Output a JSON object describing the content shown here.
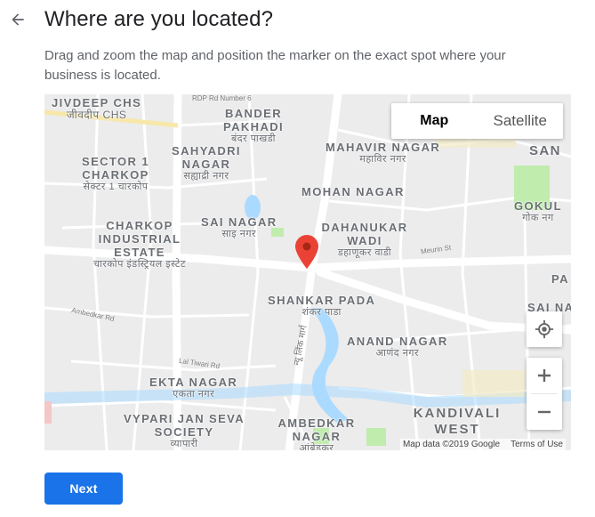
{
  "header": {
    "title": "Where are you located?",
    "subtitle": "Drag and zoom the map and position the marker on the exact spot where your business is located."
  },
  "map": {
    "type_options": [
      "Map",
      "Satellite"
    ],
    "selected_type": "Map",
    "labels": [
      {
        "en": "JIVDEEP CHS",
        "hi": "जीवदीप CHS",
        "extra": "CHS"
      },
      {
        "en": "BANDER PAKHADI",
        "hi": "बंदर पाखडी"
      },
      {
        "en": "SECTOR 1 CHARKOP",
        "hi": "सेक्टर 1 चारकोप"
      },
      {
        "en": "SAHYADRI NAGAR",
        "hi": "सह्याद्री नगर"
      },
      {
        "en": "MAHAVIR NAGAR",
        "hi": "महाविर नगर"
      },
      {
        "en": "MOHAN NAGAR"
      },
      {
        "en": "CHARKOP INDUSTRIAL ESTATE",
        "hi": "चारकोप इंडस्ट्रियल इस्टेट"
      },
      {
        "en": "SAI NAGAR",
        "hi": "साइ नगर"
      },
      {
        "en": "DAHANUKAR WADI",
        "hi": "डहाणूकर वाडी"
      },
      {
        "en": "GOKUL",
        "hi": "गोक नग"
      },
      {
        "en": "SHANKAR PADA",
        "hi": "शंकर पाडा"
      },
      {
        "en": "ANAND NAGAR",
        "hi": "आणंद नगर"
      },
      {
        "en": "EKTA NAGAR",
        "hi": "एकता नगर"
      },
      {
        "en": "VYPARI JAN SEVA SOCIETY",
        "hi": "व्यापारी"
      },
      {
        "en": "AMBEDKAR NAGAR",
        "hi": "आंबेडकर"
      },
      {
        "en": "KANDIVALI WEST"
      },
      {
        "en": "SAN"
      },
      {
        "en": "PA"
      },
      {
        "en": "SAI NA"
      }
    ],
    "road_labels": [
      "RDP Rd Number 6",
      "Meurin St",
      "Ambedkar Rd",
      "Lal Tiwari Rd",
      "न्यू लिंक मार्ग"
    ],
    "attribution": "Map data ©2019 Google",
    "terms": "Terms of Use",
    "controls": {
      "locate": "my-location",
      "zoom_in": "+",
      "zoom_out": "−"
    }
  },
  "footer": {
    "next_label": "Next"
  },
  "colors": {
    "primary": "#1a73e8",
    "pin": "#ea4335",
    "water": "#aadaff",
    "park": "#c0ecae",
    "land": "#ececec"
  }
}
